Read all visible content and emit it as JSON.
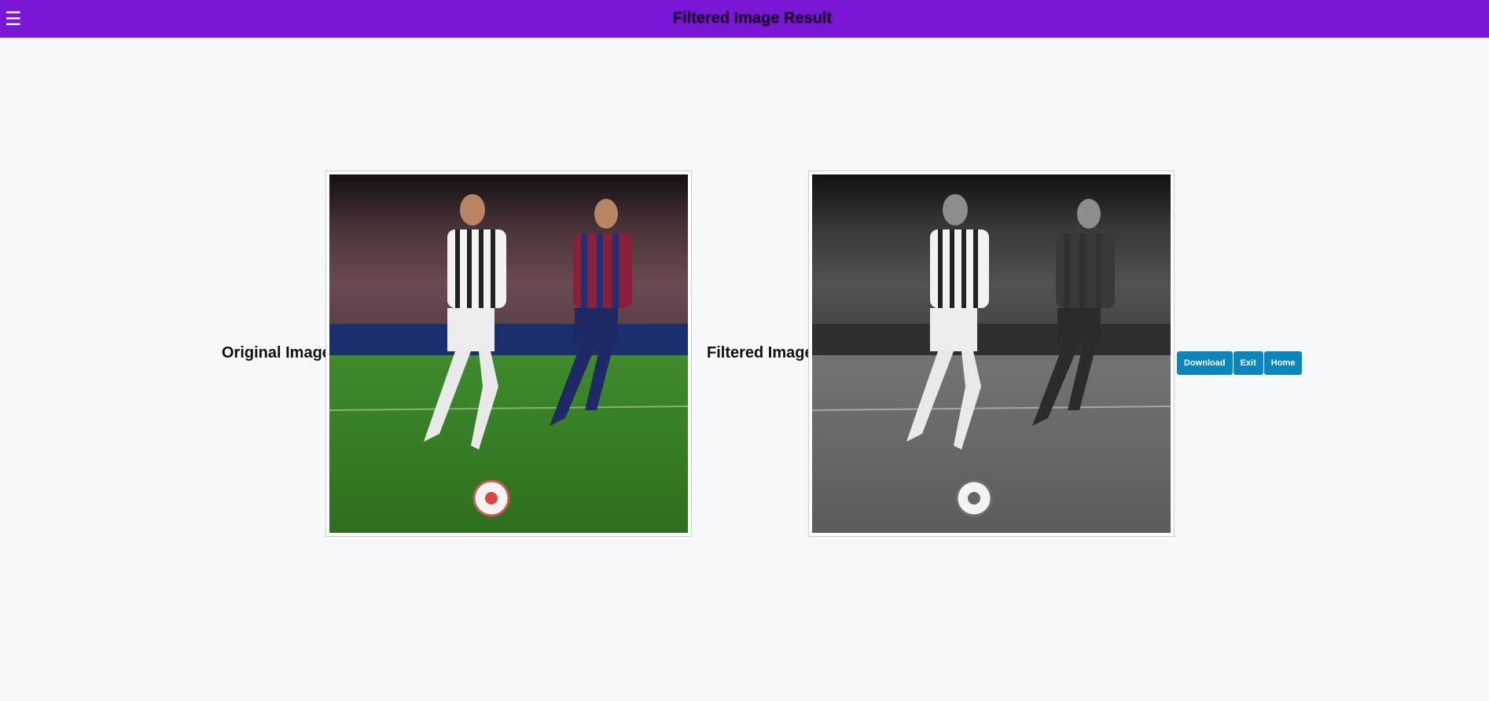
{
  "header": {
    "menu_icon": "hamburger-icon",
    "title": "Filtered Image Result"
  },
  "original": {
    "label": "Original Image"
  },
  "filtered": {
    "label": "Filtered Image",
    "filter": "grayscale"
  },
  "actions": {
    "download_label": "Download",
    "exit_label": "Exit",
    "home_label": "Home"
  },
  "colors": {
    "header_bg": "#7a17d6",
    "button_bg": "#0a86bd",
    "page_bg": "#f7f8fa"
  }
}
